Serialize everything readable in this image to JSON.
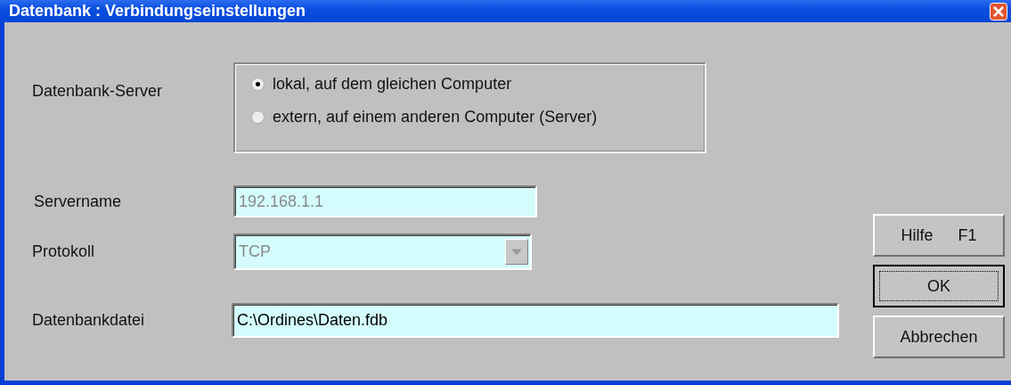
{
  "window": {
    "title": "Datenbank : Verbindungseinstellungen"
  },
  "server_choice": {
    "label": "Datenbank-Server",
    "options": [
      {
        "label": "lokal, auf dem gleichen Computer",
        "selected": true
      },
      {
        "label": "extern, auf einem anderen Computer (Server)",
        "selected": false
      }
    ]
  },
  "fields": [
    {
      "kind": "text",
      "label": "Servername",
      "value": "192.168.1.1",
      "disabled": true
    },
    {
      "kind": "combo",
      "label": "Protokoll",
      "value": "TCP",
      "disabled": true
    },
    {
      "kind": "text",
      "label": "Datenbankdatei",
      "value": "C:\\Ordines\\Daten.fdb",
      "disabled": false
    }
  ],
  "buttons": [
    {
      "label": "Hilfe",
      "shortcut": "F1",
      "default": false
    },
    {
      "label": "OK",
      "default": true
    },
    {
      "label": "Abbrechen",
      "default": false
    }
  ]
}
